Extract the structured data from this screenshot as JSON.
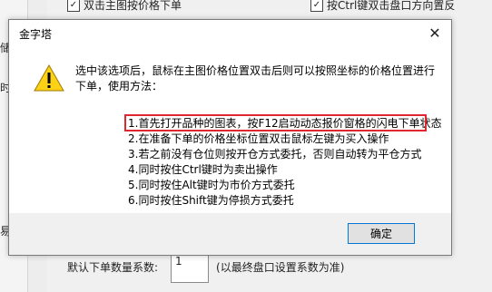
{
  "background": {
    "left_labels": [
      "储",
      "时图",
      "易"
    ],
    "checkbox_left": {
      "label": "双击主图按价格下单",
      "checked": true
    },
    "checkbox_right": {
      "label": "按Ctrl键双击盘口方向置反",
      "checked": true
    },
    "quantity_label": "默认下单数量系数:",
    "quantity_value": "1",
    "quantity_hint": "(以最终盘口设置系数为准)"
  },
  "dialog": {
    "title": "金字塔",
    "icon": "warning-icon",
    "close_icon": "close-icon",
    "intro": "选中该选项后，鼠标在主图价格位置双击后则可以按照坐标的价格位置进行下单，使用方法：",
    "steps": [
      "1.首先打开品种的图表，按F12启动动态报价窗格的闪电下单状态",
      "2.在准备下单的价格坐标位置双击鼠标左键为买入操作",
      "3.若之前没有仓位则按开仓方式委托，否则自动转为平仓方式",
      "4.同时按住Ctrl键时为卖出操作",
      "5.同时按住Alt键时为市价方式委托",
      "6.同时按住Shift键为停损方式委托"
    ],
    "ok_label": "确定",
    "highlight_color": "#e0262e"
  }
}
